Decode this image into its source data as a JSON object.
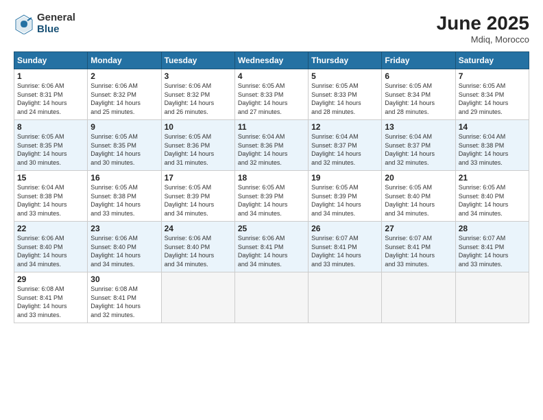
{
  "header": {
    "logo_general": "General",
    "logo_blue": "Blue",
    "month_title": "June 2025",
    "location": "Mdiq, Morocco"
  },
  "weekdays": [
    "Sunday",
    "Monday",
    "Tuesday",
    "Wednesday",
    "Thursday",
    "Friday",
    "Saturday"
  ],
  "weeks": [
    [
      {
        "day": "1",
        "info": "Sunrise: 6:06 AM\nSunset: 8:31 PM\nDaylight: 14 hours\nand 24 minutes."
      },
      {
        "day": "2",
        "info": "Sunrise: 6:06 AM\nSunset: 8:32 PM\nDaylight: 14 hours\nand 25 minutes."
      },
      {
        "day": "3",
        "info": "Sunrise: 6:06 AM\nSunset: 8:32 PM\nDaylight: 14 hours\nand 26 minutes."
      },
      {
        "day": "4",
        "info": "Sunrise: 6:05 AM\nSunset: 8:33 PM\nDaylight: 14 hours\nand 27 minutes."
      },
      {
        "day": "5",
        "info": "Sunrise: 6:05 AM\nSunset: 8:33 PM\nDaylight: 14 hours\nand 28 minutes."
      },
      {
        "day": "6",
        "info": "Sunrise: 6:05 AM\nSunset: 8:34 PM\nDaylight: 14 hours\nand 28 minutes."
      },
      {
        "day": "7",
        "info": "Sunrise: 6:05 AM\nSunset: 8:34 PM\nDaylight: 14 hours\nand 29 minutes."
      }
    ],
    [
      {
        "day": "8",
        "info": "Sunrise: 6:05 AM\nSunset: 8:35 PM\nDaylight: 14 hours\nand 30 minutes."
      },
      {
        "day": "9",
        "info": "Sunrise: 6:05 AM\nSunset: 8:35 PM\nDaylight: 14 hours\nand 30 minutes."
      },
      {
        "day": "10",
        "info": "Sunrise: 6:05 AM\nSunset: 8:36 PM\nDaylight: 14 hours\nand 31 minutes."
      },
      {
        "day": "11",
        "info": "Sunrise: 6:04 AM\nSunset: 8:36 PM\nDaylight: 14 hours\nand 32 minutes."
      },
      {
        "day": "12",
        "info": "Sunrise: 6:04 AM\nSunset: 8:37 PM\nDaylight: 14 hours\nand 32 minutes."
      },
      {
        "day": "13",
        "info": "Sunrise: 6:04 AM\nSunset: 8:37 PM\nDaylight: 14 hours\nand 32 minutes."
      },
      {
        "day": "14",
        "info": "Sunrise: 6:04 AM\nSunset: 8:38 PM\nDaylight: 14 hours\nand 33 minutes."
      }
    ],
    [
      {
        "day": "15",
        "info": "Sunrise: 6:04 AM\nSunset: 8:38 PM\nDaylight: 14 hours\nand 33 minutes."
      },
      {
        "day": "16",
        "info": "Sunrise: 6:05 AM\nSunset: 8:38 PM\nDaylight: 14 hours\nand 33 minutes."
      },
      {
        "day": "17",
        "info": "Sunrise: 6:05 AM\nSunset: 8:39 PM\nDaylight: 14 hours\nand 34 minutes."
      },
      {
        "day": "18",
        "info": "Sunrise: 6:05 AM\nSunset: 8:39 PM\nDaylight: 14 hours\nand 34 minutes."
      },
      {
        "day": "19",
        "info": "Sunrise: 6:05 AM\nSunset: 8:39 PM\nDaylight: 14 hours\nand 34 minutes."
      },
      {
        "day": "20",
        "info": "Sunrise: 6:05 AM\nSunset: 8:40 PM\nDaylight: 14 hours\nand 34 minutes."
      },
      {
        "day": "21",
        "info": "Sunrise: 6:05 AM\nSunset: 8:40 PM\nDaylight: 14 hours\nand 34 minutes."
      }
    ],
    [
      {
        "day": "22",
        "info": "Sunrise: 6:06 AM\nSunset: 8:40 PM\nDaylight: 14 hours\nand 34 minutes."
      },
      {
        "day": "23",
        "info": "Sunrise: 6:06 AM\nSunset: 8:40 PM\nDaylight: 14 hours\nand 34 minutes."
      },
      {
        "day": "24",
        "info": "Sunrise: 6:06 AM\nSunset: 8:40 PM\nDaylight: 14 hours\nand 34 minutes."
      },
      {
        "day": "25",
        "info": "Sunrise: 6:06 AM\nSunset: 8:41 PM\nDaylight: 14 hours\nand 34 minutes."
      },
      {
        "day": "26",
        "info": "Sunrise: 6:07 AM\nSunset: 8:41 PM\nDaylight: 14 hours\nand 33 minutes."
      },
      {
        "day": "27",
        "info": "Sunrise: 6:07 AM\nSunset: 8:41 PM\nDaylight: 14 hours\nand 33 minutes."
      },
      {
        "day": "28",
        "info": "Sunrise: 6:07 AM\nSunset: 8:41 PM\nDaylight: 14 hours\nand 33 minutes."
      }
    ],
    [
      {
        "day": "29",
        "info": "Sunrise: 6:08 AM\nSunset: 8:41 PM\nDaylight: 14 hours\nand 33 minutes."
      },
      {
        "day": "30",
        "info": "Sunrise: 6:08 AM\nSunset: 8:41 PM\nDaylight: 14 hours\nand 32 minutes."
      },
      {
        "day": "",
        "info": ""
      },
      {
        "day": "",
        "info": ""
      },
      {
        "day": "",
        "info": ""
      },
      {
        "day": "",
        "info": ""
      },
      {
        "day": "",
        "info": ""
      }
    ]
  ]
}
